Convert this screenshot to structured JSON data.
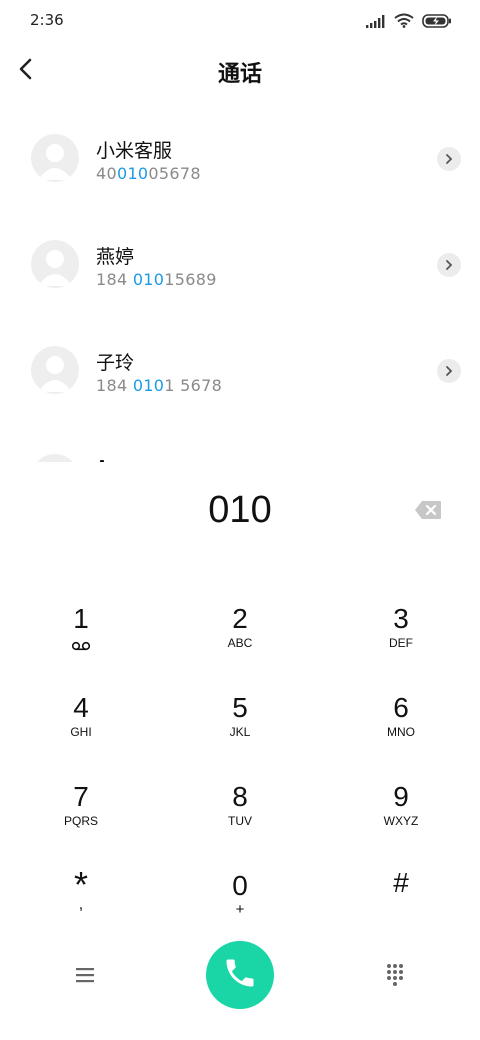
{
  "status_bar": {
    "time": "2:36",
    "signal_icon": "signal-icon",
    "wifi_icon": "wifi-icon",
    "battery_icon": "battery-charging-icon"
  },
  "header": {
    "title": "通话",
    "back_icon": "chevron-left-icon"
  },
  "contacts": [
    {
      "name": "小米客服",
      "number_pre": "40",
      "number_match": "010",
      "number_post": "05678"
    },
    {
      "name": "燕婷",
      "number_pre": "184 ",
      "number_match": "010",
      "number_post": "15689"
    },
    {
      "name": "子玲",
      "number_pre": "184 ",
      "number_match": "010",
      "number_post": "1 5678"
    }
  ],
  "dialer": {
    "input": "010",
    "delete_icon": "backspace-icon"
  },
  "keypad": [
    {
      "digit": "1",
      "letters": ""
    },
    {
      "digit": "2",
      "letters": "ABC"
    },
    {
      "digit": "3",
      "letters": "DEF"
    },
    {
      "digit": "4",
      "letters": "GHI"
    },
    {
      "digit": "5",
      "letters": "JKL"
    },
    {
      "digit": "6",
      "letters": "MNO"
    },
    {
      "digit": "7",
      "letters": "PQRS"
    },
    {
      "digit": "8",
      "letters": "TUV"
    },
    {
      "digit": "9",
      "letters": "WXYZ"
    },
    {
      "digit": "*",
      "letters": ","
    },
    {
      "digit": "0",
      "letters": "+"
    },
    {
      "digit": "#",
      "letters": ""
    }
  ],
  "bottom_bar": {
    "menu_icon": "menu-icon",
    "call_icon": "phone-icon",
    "keypad_icon": "dialpad-icon"
  },
  "colors": {
    "highlight": "#1a9be6",
    "call_button": "#1ad6a6",
    "muted_text": "#8a8a8a"
  }
}
